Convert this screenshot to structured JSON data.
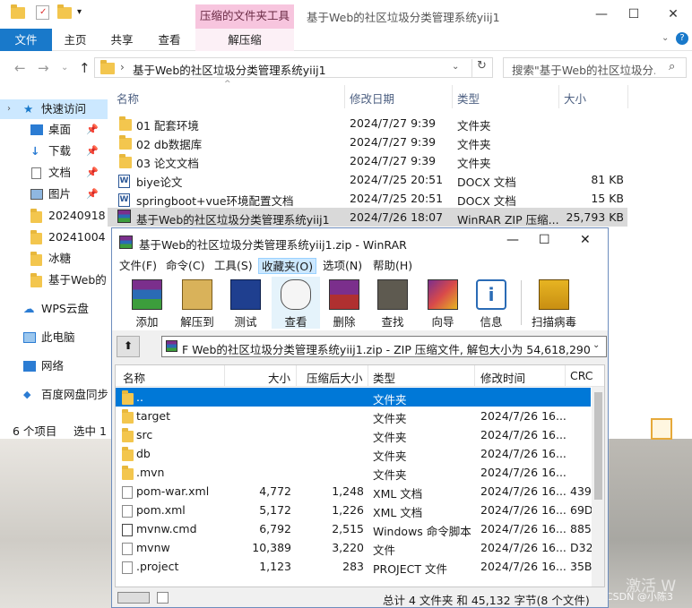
{
  "explorer": {
    "compressed_tab_header": "压缩的文件夹工具",
    "title": "基于Web的社区垃圾分类管理系统yiij1",
    "ribbon": {
      "file": "文件",
      "tabs": [
        "主页",
        "共享",
        "查看",
        "解压缩"
      ]
    },
    "address": "基于Web的社区垃圾分类管理系统yiij1",
    "search_placeholder": "搜索\"基于Web的社区垃圾分...",
    "sidebar": [
      {
        "label": "快速访问",
        "icon": "star-icon"
      },
      {
        "label": "桌面",
        "icon": "desktop-icon",
        "pinned": true
      },
      {
        "label": "下载",
        "icon": "download-icon",
        "pinned": true
      },
      {
        "label": "文档",
        "icon": "document-icon",
        "pinned": true
      },
      {
        "label": "图片",
        "icon": "picture-icon",
        "pinned": true
      },
      {
        "label": "20240918",
        "icon": "folder-icon"
      },
      {
        "label": "20241004",
        "icon": "folder-icon"
      },
      {
        "label": "冰糖",
        "icon": "folder-icon"
      },
      {
        "label": "基于Web的",
        "icon": "folder-icon"
      },
      {
        "label": "WPS云盘",
        "icon": "cloud-icon"
      },
      {
        "label": "此电脑",
        "icon": "computer-icon"
      },
      {
        "label": "网络",
        "icon": "network-icon"
      },
      {
        "label": "百度网盘同步",
        "icon": "baidu-icon"
      }
    ],
    "columns": {
      "name": "名称",
      "date": "修改日期",
      "type": "类型",
      "size": "大小"
    },
    "files": [
      {
        "name": "01 配套环境",
        "date": "2024/7/27 9:39",
        "type": "文件夹",
        "size": "",
        "icon": "folder-icon"
      },
      {
        "name": "02 db数据库",
        "date": "2024/7/27 9:39",
        "type": "文件夹",
        "size": "",
        "icon": "folder-icon"
      },
      {
        "name": "03 论文文档",
        "date": "2024/7/27 9:39",
        "type": "文件夹",
        "size": "",
        "icon": "folder-icon"
      },
      {
        "name": "biye论文",
        "date": "2024/7/25 20:51",
        "type": "DOCX 文档",
        "size": "81 KB",
        "icon": "word-icon"
      },
      {
        "name": "springboot+vue环境配置文档",
        "date": "2024/7/25 20:51",
        "type": "DOCX 文档",
        "size": "15 KB",
        "icon": "word-icon"
      },
      {
        "name": "基于Web的社区垃圾分类管理系统yiij1",
        "date": "2024/7/26 18:07",
        "type": "WinRAR ZIP 压缩...",
        "size": "25,793 KB",
        "icon": "rar-icon"
      }
    ],
    "status": {
      "count": "6 个项目",
      "selected": "选中 1"
    }
  },
  "winrar": {
    "title": "基于Web的社区垃圾分类管理系统yiij1.zip - WinRAR",
    "menu": [
      "文件(F)",
      "命令(C)",
      "工具(S)",
      "收藏夹(O)",
      "选项(N)",
      "帮助(H)"
    ],
    "tools": [
      "添加",
      "解压到",
      "测试",
      "查看",
      "删除",
      "查找",
      "向导",
      "信息",
      "扫描病毒"
    ],
    "path": "F Web的社区垃圾分类管理系统yiij1.zip - ZIP 压缩文件, 解包大小为 54,618,290 字节",
    "columns": {
      "name": "名称",
      "size": "大小",
      "packed": "压缩后大小",
      "type": "类型",
      "modified": "修改时间",
      "crc": "CRC"
    },
    "rows": [
      {
        "name": "..",
        "size": "",
        "packed": "",
        "type": "文件夹",
        "modified": "",
        "crc": "",
        "icon": "folder-icon"
      },
      {
        "name": "target",
        "size": "",
        "packed": "",
        "type": "文件夹",
        "modified": "2024/7/26 16...",
        "crc": "",
        "icon": "folder-icon"
      },
      {
        "name": "src",
        "size": "",
        "packed": "",
        "type": "文件夹",
        "modified": "2024/7/26 16...",
        "crc": "",
        "icon": "folder-icon"
      },
      {
        "name": "db",
        "size": "",
        "packed": "",
        "type": "文件夹",
        "modified": "2024/7/26 16...",
        "crc": "",
        "icon": "folder-icon"
      },
      {
        "name": ".mvn",
        "size": "",
        "packed": "",
        "type": "文件夹",
        "modified": "2024/7/26 16...",
        "crc": "",
        "icon": "folder-icon"
      },
      {
        "name": "pom-war.xml",
        "size": "4,772",
        "packed": "1,248",
        "type": "XML 文档",
        "modified": "2024/7/26 16...",
        "crc": "439",
        "icon": "xml-icon"
      },
      {
        "name": "pom.xml",
        "size": "5,172",
        "packed": "1,226",
        "type": "XML 文档",
        "modified": "2024/7/26 16...",
        "crc": "69D",
        "icon": "xml-icon"
      },
      {
        "name": "mvnw.cmd",
        "size": "6,792",
        "packed": "2,515",
        "type": "Windows 命令脚本",
        "modified": "2024/7/26 16...",
        "crc": "885",
        "icon": "cmd-icon"
      },
      {
        "name": "mvnw",
        "size": "10,389",
        "packed": "3,220",
        "type": "文件",
        "modified": "2024/7/26 16...",
        "crc": "D32",
        "icon": "file-icon"
      },
      {
        "name": ".project",
        "size": "1,123",
        "packed": "283",
        "type": "PROJECT 文件",
        "modified": "2024/7/26 16...",
        "crc": "35B",
        "icon": "file-icon"
      }
    ],
    "status": "总计 4 文件夹 和 45,132 字节(8 个文件)"
  },
  "watermark": {
    "csdn": "CSDN @小陈3",
    "activate": "激活 W"
  }
}
